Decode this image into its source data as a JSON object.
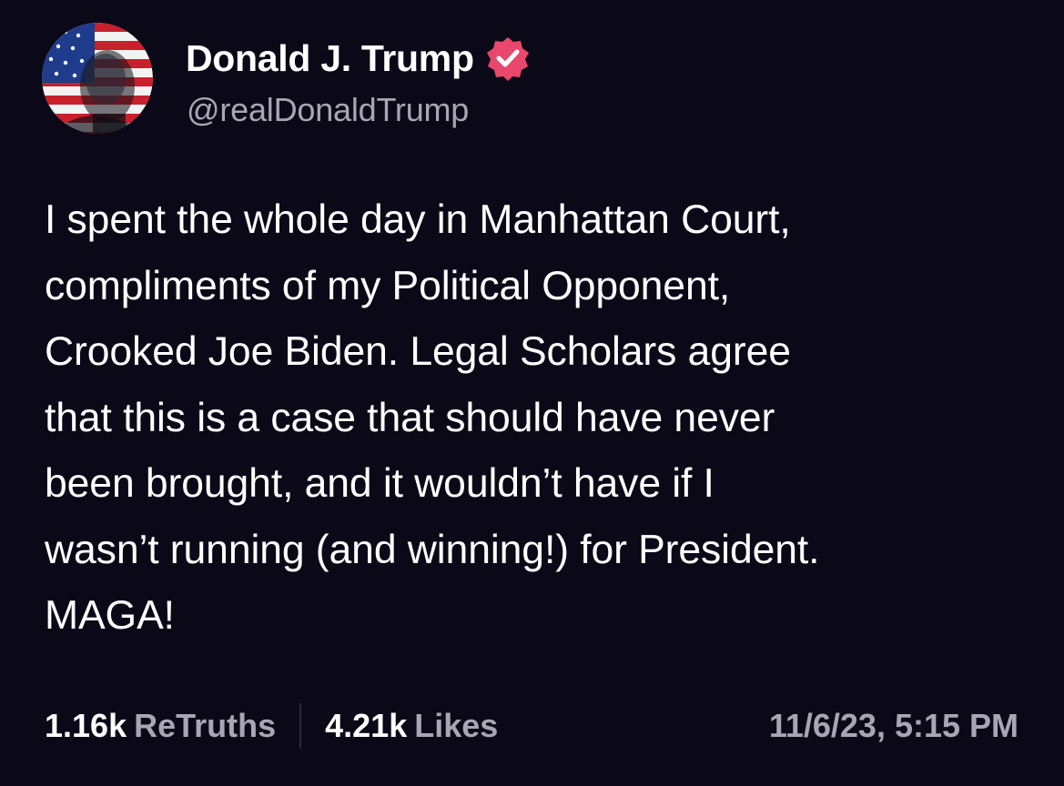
{
  "author": {
    "display_name": "Donald J. Trump",
    "handle": "@realDonaldTrump",
    "verified": true,
    "verified_badge_color": "#e8486b",
    "avatar_icon": "flag-portrait-avatar"
  },
  "post": {
    "text": "I spent the whole day in Manhattan Court,\ncompliments of my Political Opponent,\nCrooked Joe Biden. Legal Scholars agree\nthat this is a case that should have never\nbeen brought, and it wouldn’t have if I\nwasn’t running (and winning!) for President.\nMAGA!",
    "timestamp": "11/6/23, 5:15 PM"
  },
  "stats": {
    "retruths_count": "1.16k",
    "retruths_label": "ReTruths",
    "likes_count": "4.21k",
    "likes_label": "Likes"
  },
  "colors": {
    "background": "#0b0817",
    "primary_text": "#ffffff",
    "secondary_text": "#a8a6b6"
  }
}
